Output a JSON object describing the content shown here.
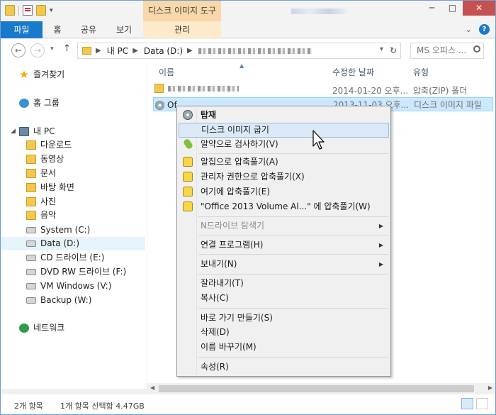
{
  "titlebar": {
    "context_tab_title": "디스크 이미지 도구",
    "buttons": {
      "minimize": "─",
      "maximize": "□",
      "close": "✕"
    }
  },
  "ribbon": {
    "tabs": [
      "파일",
      "홈",
      "공유",
      "보기",
      "관리"
    ],
    "collapse_glyph": "⌄",
    "help_glyph": "?"
  },
  "address": {
    "back_glyph": "←",
    "forward_glyph": "→",
    "recent_glyph": "▾",
    "up_glyph": "↑",
    "crumbs": [
      "내 PC",
      "Data (D:)"
    ],
    "crumb_sep": "▶",
    "refresh_glyph": "↻",
    "dropdown_glyph": "▾",
    "search_placeholder": "MS 오피스 ..."
  },
  "nav": {
    "favorites": "즐겨찾기",
    "homegroup": "홈 그룹",
    "thispc": "내 PC",
    "expand_glyph": "◢",
    "items": [
      "다운로드",
      "동영상",
      "문서",
      "바탕 화면",
      "사진",
      "음악",
      "System (C:)",
      "Data (D:)",
      "CD 드라이브 (E:)",
      "DVD RW 드라이브 (F:)",
      "VM Windows (V:)",
      "Backup (W:)"
    ],
    "network": "네트워크",
    "selected": "Data (D:)"
  },
  "filelist": {
    "columns": {
      "name": "이름",
      "modified": "수정한 날짜",
      "type": "유형"
    },
    "sort_glyph": "▲",
    "rows": [
      {
        "name": "",
        "date": "2014-01-20 오후...",
        "type": "압축(ZIP) 폴더"
      },
      {
        "name": "Of",
        "date": "2013-11-03 오후...",
        "type": "디스크 이미지 파일"
      }
    ]
  },
  "scroll": {
    "left_glyph": "◀",
    "right_glyph": "▶"
  },
  "status": {
    "count": "2개 항목",
    "selection": "1개 항목 선택함 4.47GB"
  },
  "context_menu": {
    "items": [
      {
        "label": "탑재"
      },
      {
        "label": "디스크 이미지 굽기"
      },
      {
        "label": "알약으로 검사하기(V)"
      },
      {
        "label": "알집으로 압축풀기(A)"
      },
      {
        "label": "관리자 권한으로 압축풀기(X)"
      },
      {
        "label": "여기에 압축풀기(E)"
      },
      {
        "label": "\"Office 2013 Volume Al...\" 에 압축풀기(W)"
      },
      {
        "label": "N드라이브 탐색기"
      },
      {
        "label": "연결 프로그램(H)"
      },
      {
        "label": "보내기(N)"
      },
      {
        "label": "잘라내기(T)"
      },
      {
        "label": "복사(C)"
      },
      {
        "label": "바로 가기 만들기(S)"
      },
      {
        "label": "삭제(D)"
      },
      {
        "label": "이름 바꾸기(M)"
      },
      {
        "label": "속성(R)"
      }
    ],
    "submenu_glyph": "▶",
    "hovered": "디스크 이미지 굽기",
    "disabled": "N드라이브 탐색기"
  }
}
